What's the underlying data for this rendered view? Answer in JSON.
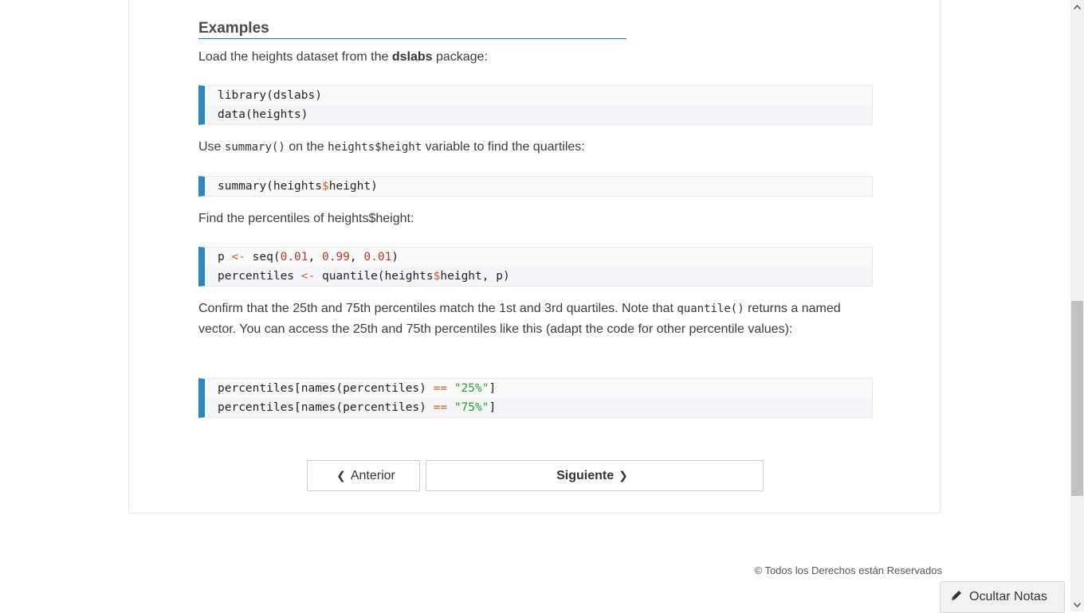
{
  "section": {
    "title": "Examples"
  },
  "intro": {
    "pre": "Load the heights dataset from the ",
    "bold": "dslabs",
    "post": " package:"
  },
  "code1": [
    {
      "parts": [
        {
          "t": "library(dslabs)",
          "c": ""
        }
      ]
    },
    {
      "parts": [
        {
          "t": "data(heights)",
          "c": ""
        }
      ]
    }
  ],
  "para2": {
    "a": "Use ",
    "code1": "summary()",
    "b": " on the ",
    "code2": "heights$height",
    "c": " variable to find the quartiles:"
  },
  "code2": [
    {
      "parts": [
        {
          "t": "summary(heights",
          "c": ""
        },
        {
          "t": "$",
          "c": "op"
        },
        {
          "t": "height)",
          "c": ""
        }
      ]
    }
  ],
  "para3": "Find the percentiles of heights$height:",
  "code3": [
    {
      "parts": [
        {
          "t": "p ",
          "c": ""
        },
        {
          "t": "<-",
          "c": "op"
        },
        {
          "t": " seq(",
          "c": ""
        },
        {
          "t": "0.01",
          "c": "num"
        },
        {
          "t": ", ",
          "c": ""
        },
        {
          "t": "0.99",
          "c": "num"
        },
        {
          "t": ", ",
          "c": ""
        },
        {
          "t": "0.01",
          "c": "num"
        },
        {
          "t": ")",
          "c": ""
        }
      ]
    },
    {
      "parts": [
        {
          "t": "percentiles ",
          "c": ""
        },
        {
          "t": "<-",
          "c": "op"
        },
        {
          "t": " quantile(heights",
          "c": ""
        },
        {
          "t": "$",
          "c": "op"
        },
        {
          "t": "height, p)",
          "c": ""
        }
      ]
    }
  ],
  "para4": {
    "a": "Confirm that the 25th and 75th percentiles match the 1st and 3rd quartiles. Note that ",
    "code": "quantile()",
    "b": " returns a named vector. You can access the 25th and 75th percentiles like this (adapt the code for other percentile values):"
  },
  "code4": [
    {
      "parts": [
        {
          "t": "percentiles[names(percentiles) ",
          "c": ""
        },
        {
          "t": "==",
          "c": "op"
        },
        {
          "t": " ",
          "c": ""
        },
        {
          "t": "\"25%\"",
          "c": "str"
        },
        {
          "t": "]",
          "c": ""
        }
      ]
    },
    {
      "parts": [
        {
          "t": "percentiles[names(percentiles) ",
          "c": ""
        },
        {
          "t": "==",
          "c": "op"
        },
        {
          "t": " ",
          "c": ""
        },
        {
          "t": "\"75%\"",
          "c": "str"
        },
        {
          "t": "]",
          "c": ""
        }
      ]
    }
  ],
  "nav": {
    "prev_label": "Anterior",
    "next_label": "Siguiente"
  },
  "footer": {
    "text": "Todos los Derechos están Reservados",
    "icon": "copyright-icon"
  },
  "notes_button": {
    "label": "Ocultar Notas",
    "icon": "pencil-icon"
  },
  "colors": {
    "accent": "#2e86c1",
    "heading_rule": "#1f77b4",
    "operator": "#c0612b",
    "number": "#b03a2e",
    "string": "#2a9a2a"
  }
}
